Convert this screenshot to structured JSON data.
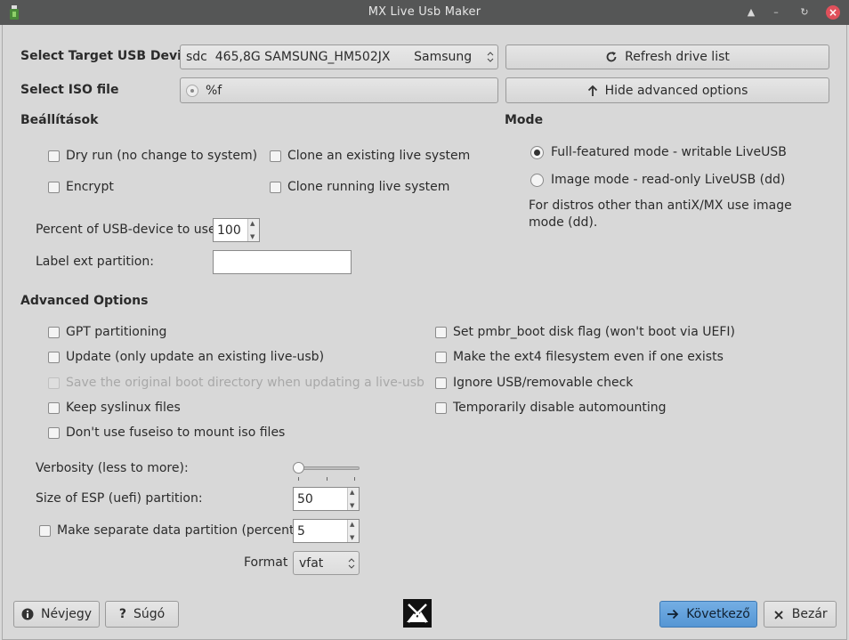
{
  "window": {
    "title": "MX Live Usb Maker"
  },
  "target": {
    "label": "Select Target USB Device",
    "device_value": "sdc  465,8G SAMSUNG_HM502JX      Samsung",
    "refresh_label": "Refresh drive list"
  },
  "iso": {
    "label": "Select ISO file",
    "value": "%f",
    "hide_label": "Hide advanced options"
  },
  "settings": {
    "heading": "Beállítások",
    "dry_run": "Dry run (no change to system)",
    "clone_existing": "Clone an existing live system",
    "encrypt": "Encrypt",
    "clone_running": "Clone running live system",
    "percent_label": "Percent of USB-device to use:",
    "percent_value": "100",
    "label_ext": "Label ext partition:"
  },
  "mode": {
    "heading": "Mode",
    "full": "Full-featured mode - writable LiveUSB",
    "image": "Image mode - read-only LiveUSB (dd)",
    "note": "For distros other than antiX/MX use image mode (dd)."
  },
  "advanced": {
    "heading": "Advanced Options",
    "gpt": "GPT partitioning",
    "update": "Update (only update an existing live-usb)",
    "save_boot": "Save the original boot directory when updating a live-usb",
    "keep_syslinux": "Keep syslinux files",
    "no_fuseiso": "Don't use fuseiso to mount iso files",
    "pmbr": "Set pmbr_boot disk flag (won't boot via UEFI)",
    "ext4": "Make the ext4 filesystem even if one exists",
    "ignore_usb": "Ignore USB/removable check",
    "disable_automount": "Temporarily disable automounting",
    "verbosity_label": "Verbosity (less to more):",
    "verbosity_level": 0,
    "esp_label": "Size of ESP (uefi) partition:",
    "esp_value": "50",
    "data_part_label": "Make separate data partition (percent)",
    "data_part_value": "5",
    "format_label": "Format",
    "format_value": "vfat"
  },
  "footer": {
    "about": "Névjegy",
    "help": "Súgó",
    "next": "Következő",
    "close": "Bezár"
  }
}
